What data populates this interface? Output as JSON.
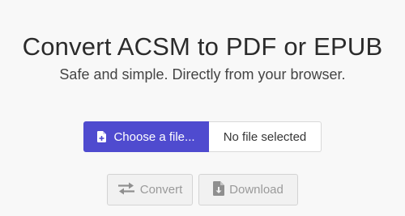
{
  "header": {
    "title": "Convert ACSM to PDF or EPUB",
    "subtitle": "Safe and simple. Directly from your browser."
  },
  "file_input": {
    "choose_label": "Choose a file...",
    "status": "No file selected",
    "choose_icon": "file-plus-icon"
  },
  "actions": {
    "convert_label": "Convert",
    "convert_icon": "exchange-arrows-icon",
    "download_label": "Download",
    "download_icon": "file-download-icon"
  },
  "colors": {
    "primary": "#4f4bcf",
    "disabled_text": "#9a9a9a",
    "background": "#f8f8f8"
  }
}
